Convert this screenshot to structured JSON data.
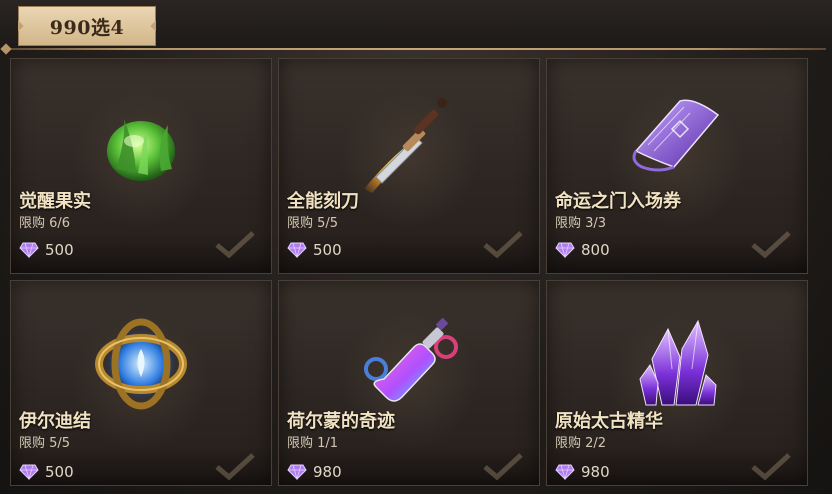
{
  "header": {
    "title": "990选4"
  },
  "price_icon": "purple-diamond-icon",
  "items": [
    {
      "name": "觉醒果实",
      "limit": "限购 6/6",
      "price": "500",
      "icon": "green-fruit-icon"
    },
    {
      "name": "全能刻刀",
      "limit": "限购 5/5",
      "price": "500",
      "icon": "dagger-icon"
    },
    {
      "name": "命运之门入场券",
      "limit": "限购 3/3",
      "price": "800",
      "icon": "ticket-scroll-icon"
    },
    {
      "name": "伊尔迪结",
      "limit": "限购 5/5",
      "price": "500",
      "icon": "ring-knot-icon"
    },
    {
      "name": "荷尔蒙的奇迹",
      "limit": "限购 1/1",
      "price": "980",
      "icon": "potion-bottle-icon"
    },
    {
      "name": "原始太古精华",
      "limit": "限购 2/2",
      "price": "980",
      "icon": "purple-crystal-icon"
    }
  ]
}
